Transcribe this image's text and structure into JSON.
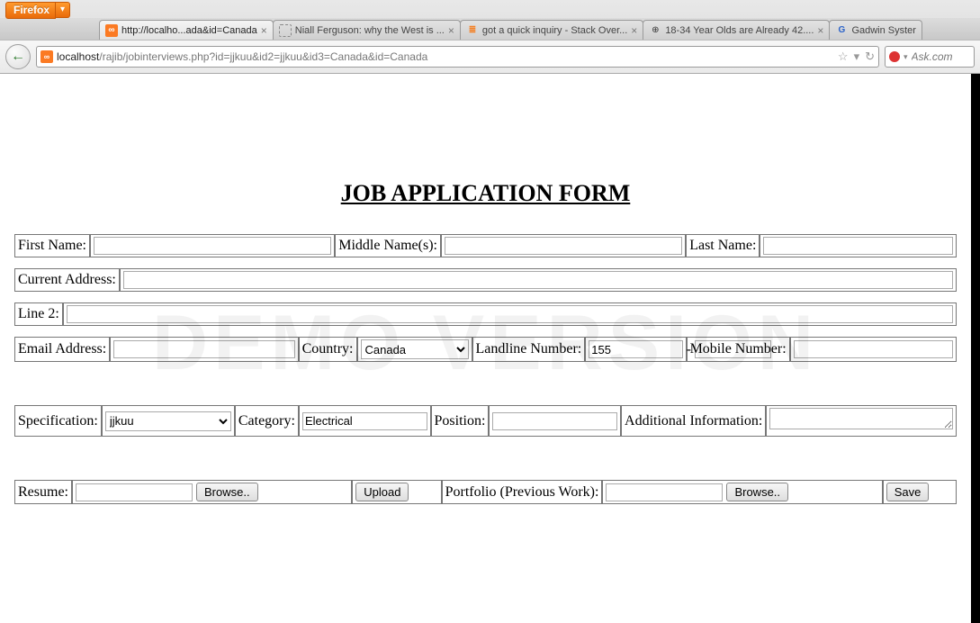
{
  "chrome": {
    "firefox_label": "Firefox",
    "tabs": [
      {
        "title": "http://localho...ada&id=Canada",
        "favicon": "xampp",
        "active": true
      },
      {
        "title": "Niall Ferguson: why the West is ...",
        "favicon": "dotted",
        "active": false
      },
      {
        "title": "got a quick inquiry - Stack Over...",
        "favicon": "so",
        "active": false
      },
      {
        "title": "18-34 Year Olds are Already 42....",
        "favicon": "globe",
        "active": false
      },
      {
        "title": "Gadwin Syster",
        "favicon": "g",
        "active": false
      }
    ],
    "url_host": "localhost",
    "url_path": "/rajib/jobinterviews.php?id=jjkuu&id2=jjkuu&id3=Canada&id=Canada",
    "search_placeholder": "Ask.com"
  },
  "watermark": "DEMO VERSION",
  "form": {
    "title": "JOB APPLICATION FORM",
    "first_name_label": "First Name:",
    "first_name_value": "",
    "middle_name_label": "Middle Name(s):",
    "middle_name_value": "",
    "last_name_label": "Last Name:",
    "last_name_value": "",
    "current_address_label": "Current Address:",
    "current_address_value": "",
    "line2_label": "Line 2:",
    "line2_value": "",
    "email_label": "Email Address:",
    "email_value": "",
    "country_label": "Country:",
    "country_value": "Canada",
    "landline_label": "Landline Number:",
    "landline_code": "155",
    "landline_dash": "-",
    "landline_value": "",
    "mobile_label": "Mobile Number:",
    "mobile_value": "",
    "specification_label": "Specification:",
    "specification_value": "jjkuu",
    "category_label": "Category:",
    "category_value": "Electrical",
    "position_label": "Position:",
    "position_value": "",
    "addinfo_label": "Additional Information:",
    "addinfo_value": "",
    "resume_label": "Resume:",
    "portfolio_label": "Portfolio (Previous Work):",
    "browse_label": "Browse..",
    "upload_label": "Upload",
    "save_label": "Save"
  }
}
